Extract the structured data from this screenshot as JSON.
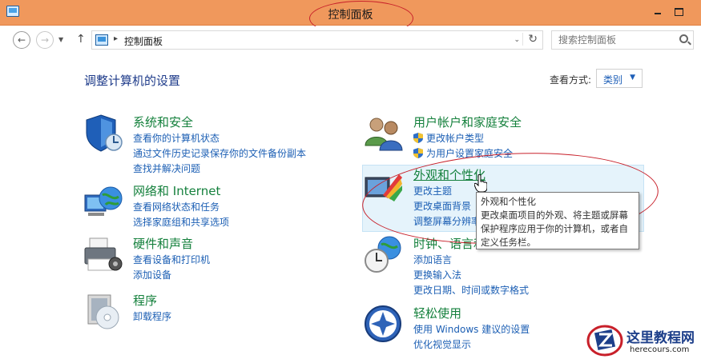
{
  "window": {
    "title": "控制面板"
  },
  "address": {
    "crumb": "控制面板",
    "search_placeholder": "搜索控制面板"
  },
  "header": {
    "heading": "调整计算机的设置",
    "view_by_label": "查看方式:",
    "view_by_value": "类别"
  },
  "categories": {
    "system_security": {
      "title": "系统和安全",
      "links": [
        "查看你的计算机状态",
        "通过文件历史记录保存你的文件备份副本",
        "查找并解决问题"
      ]
    },
    "network": {
      "title": "网络和 Internet",
      "links": [
        "查看网络状态和任务",
        "选择家庭组和共享选项"
      ]
    },
    "hardware": {
      "title": "硬件和声音",
      "links": [
        "查看设备和打印机",
        "添加设备"
      ]
    },
    "programs": {
      "title": "程序",
      "links": [
        "卸载程序"
      ]
    },
    "user_accounts": {
      "title": "用户帐户和家庭安全",
      "links": [
        "更改帐户类型",
        "为用户设置家庭安全"
      ]
    },
    "appearance": {
      "title": "外观和个性化",
      "links": [
        "更改主题",
        "更改桌面背景",
        "调整屏幕分辨率"
      ]
    },
    "clock": {
      "title": "时钟、语言和区域",
      "links": [
        "添加语言",
        "更换输入法",
        "更改日期、时间或数字格式"
      ]
    },
    "ease": {
      "title": "轻松使用",
      "links": [
        "使用 Windows 建议的设置",
        "优化视觉显示"
      ]
    }
  },
  "tooltip": {
    "title": "外观和个性化",
    "body": "更改桌面项目的外观、将主题或屏幕保护程序应用于你的计算机，或者自定义任务栏。"
  },
  "watermark": {
    "title": "这里教程网",
    "url": "herecours.com"
  },
  "colors": {
    "titlebar": "#f0985c",
    "category_title": "#14803c",
    "link": "#1c5fb4",
    "heading": "#1e3b8a",
    "annotation": "#c8202a"
  }
}
